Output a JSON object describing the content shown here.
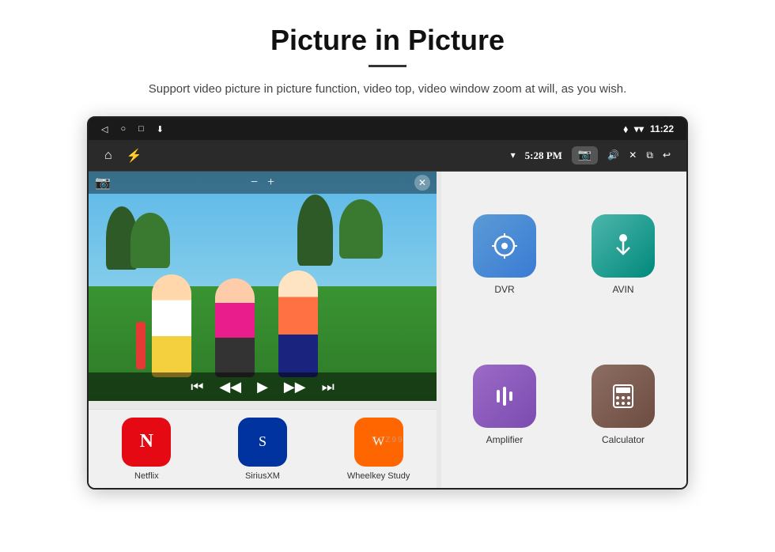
{
  "header": {
    "title": "Picture in Picture",
    "divider": true,
    "description": "Support video picture in picture function, video top, video window zoom at will, as you wish."
  },
  "statusBar": {
    "back_icon": "◁",
    "home_icon": "○",
    "recent_icon": "□",
    "download_icon": "⬇",
    "location_icon": "📍",
    "wifi_icon": "▾",
    "time": "11:22"
  },
  "navBar": {
    "home_icon": "⌂",
    "usb_icon": "⚡",
    "wifi_icon": "▾",
    "time": "5:28 PM",
    "camera_icon": "📷",
    "volume_icon": "🔊",
    "close_icon": "✕",
    "pip_icon": "⧉",
    "back_icon": "↩"
  },
  "pipWindow": {
    "camera_icon": "📷",
    "minus": "−",
    "plus": "+",
    "close": "✕",
    "prev_icon": "⏮",
    "rewind_icon": "◀◀",
    "play_icon": "▶",
    "forward_icon": "▶▶",
    "next_icon": "⏭"
  },
  "bottomApps": [
    {
      "label": "Netflix",
      "color": "#e50914",
      "icon": "N"
    },
    {
      "label": "SiriusXM",
      "color": "#0033a0",
      "icon": "S"
    },
    {
      "label": "Wheelkey Study",
      "color": "#ff6600",
      "icon": "W"
    }
  ],
  "rightApps": [
    {
      "label": "DVR",
      "color_class": "bg-blue",
      "icon": "◉"
    },
    {
      "label": "AVIN",
      "color_class": "bg-teal",
      "icon": "🔌"
    },
    {
      "label": "Amplifier",
      "color_class": "bg-purple2",
      "icon": "≡"
    },
    {
      "label": "Calculator",
      "color_class": "bg-brown",
      "icon": "⊞"
    }
  ],
  "watermark": "VCZ99"
}
